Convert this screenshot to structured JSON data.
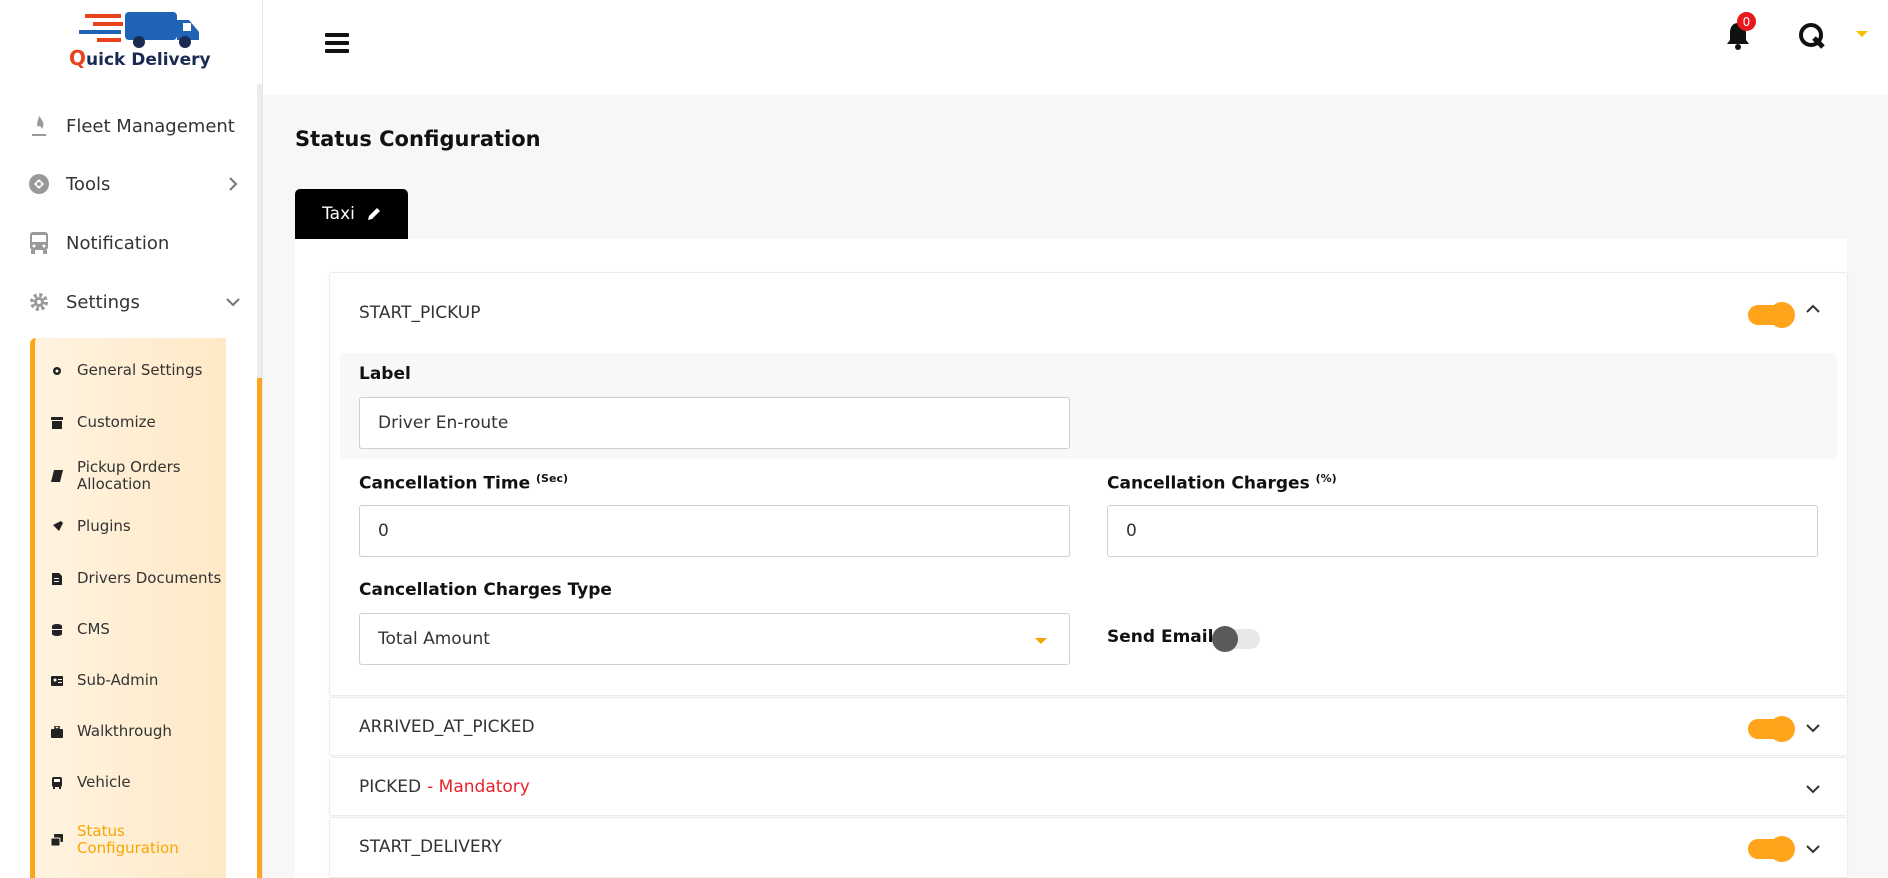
{
  "brand": {
    "logo_first": "Q",
    "logo_rest": "uick Delivery"
  },
  "sidebar": {
    "items": [
      {
        "label": "Fleet Management"
      },
      {
        "label": "Tools"
      },
      {
        "label": "Notification"
      },
      {
        "label": "Settings"
      }
    ],
    "settings_submenu": [
      {
        "label": "General Settings"
      },
      {
        "label": "Customize"
      },
      {
        "label": "Pickup Orders Allocation"
      },
      {
        "label": "Plugins"
      },
      {
        "label": "Drivers Documents"
      },
      {
        "label": "CMS"
      },
      {
        "label": "Sub-Admin"
      },
      {
        "label": "Walkthrough"
      },
      {
        "label": "Vehicle"
      },
      {
        "label": "Status Configuration"
      }
    ]
  },
  "header": {
    "notification_count": "0"
  },
  "page": {
    "title": "Status Configuration",
    "tab_label": "Taxi"
  },
  "statuses": [
    {
      "name": "START_PICKUP",
      "enabled": true,
      "expanded": true
    },
    {
      "name": "ARRIVED_AT_PICKED",
      "enabled": true,
      "expanded": false
    },
    {
      "name": "PICKED",
      "mandatory_text": "- Mandatory",
      "expanded": false
    },
    {
      "name": "START_DELIVERY",
      "enabled": true,
      "expanded": false
    }
  ],
  "form": {
    "label_title": "Label",
    "label_value": "Driver En-route",
    "cancel_time_title": "Cancellation Time",
    "cancel_time_unit": "(Sec)",
    "cancel_time_value": "0",
    "cancel_charges_title": "Cancellation Charges",
    "cancel_charges_unit": "(%)",
    "cancel_charges_value": "0",
    "charges_type_title": "Cancellation Charges Type",
    "charges_type_value": "Total Amount",
    "send_email_title": "Send Email",
    "send_email_enabled": false
  },
  "colors": {
    "accent": "#ffa41b",
    "mandatory": "#e8242a",
    "tab_bg": "#000000",
    "badge": "#e8181e"
  }
}
